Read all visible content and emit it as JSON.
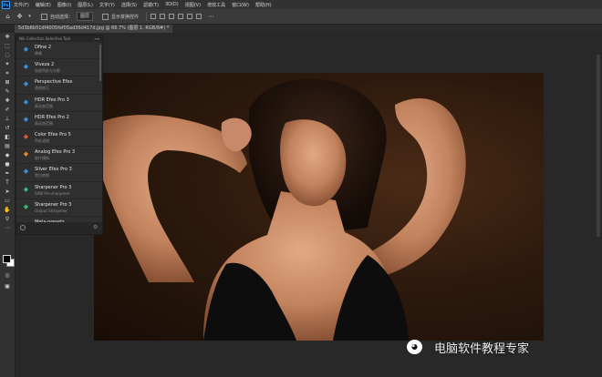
{
  "menubar": {
    "items": [
      "文件(F)",
      "编辑(E)",
      "图像(I)",
      "图层(L)",
      "文字(Y)",
      "选择(S)",
      "滤镜(T)",
      "3D(D)",
      "视图(V)",
      "增效工具",
      "窗口(W)",
      "帮助(H)"
    ]
  },
  "options": {
    "auto_select_label": "自动选择：",
    "layer_select": "图层",
    "transform_label": "显示变换控件"
  },
  "document": {
    "tab_title": "5d3b6b51df4005fef05ad36d417d.jpg @ 66.7% (图层 1, RGB/8#) *"
  },
  "plugin_panel": {
    "header": "Nik Collection Selective Tool",
    "items": [
      {
        "name": "Dfine 2",
        "sub": "降噪",
        "icon": "dfine-icon",
        "color": "#3a8fd8"
      },
      {
        "name": "Viveza 2",
        "sub": "局部色彩与光影",
        "icon": "viveza-icon",
        "color": "#3a8fd8"
      },
      {
        "name": "Perspective Efex",
        "sub": "透视校正",
        "icon": "perspective-icon",
        "color": "#3a8fd8"
      },
      {
        "name": "HDR Efex Pro 3",
        "sub": "高动态范围",
        "icon": "hdr3-icon",
        "color": "#3a8fd8"
      },
      {
        "name": "HDR Efex Pro 2",
        "sub": "高动态范围",
        "icon": "hdr2-icon",
        "color": "#3a8fd8"
      },
      {
        "name": "Color Efex Pro 5",
        "sub": "色彩滤镜",
        "icon": "color-efex5-icon",
        "color": "#e05a3a"
      },
      {
        "name": "Analog Efex Pro 3",
        "sub": "胶片模拟",
        "icon": "analog-efex3-icon",
        "color": "#e08a2a"
      },
      {
        "name": "Silver Efex Pro 3",
        "sub": "黑白转换",
        "icon": "silver-efex3-icon",
        "color": "#3a8fd8"
      },
      {
        "name": "Sharpener Pro 3",
        "sub": "RAW Pre-sharpener",
        "icon": "sharpener3-icon",
        "color": "#3ab87a"
      },
      {
        "name": "Sharpener Pro 3",
        "sub": "Output Sharpener",
        "icon": "sharpener3-output-icon",
        "color": "#3ab87a"
      },
      {
        "name": "Meta-presets",
        "sub": "预设",
        "icon": "meta-presets-icon",
        "color": "#e0b02a"
      }
    ]
  },
  "watermark": {
    "text": "电脑软件教程专家"
  }
}
